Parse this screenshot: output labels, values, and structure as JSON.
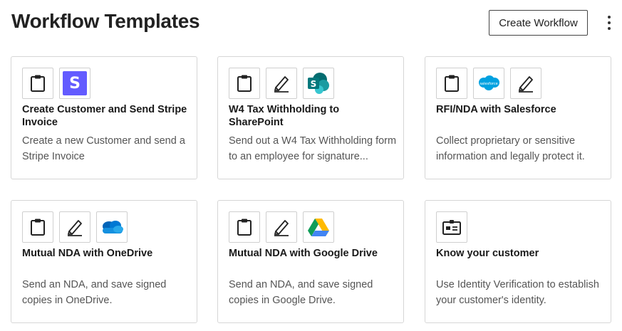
{
  "header": {
    "title": "Workflow Templates",
    "create_button_label": "Create Workflow"
  },
  "templates": [
    {
      "title": "Create Customer and Send Stripe Invoice",
      "description": "Create a new Customer and send a Stripe Invoice",
      "icons": [
        "clipboard-icon",
        "stripe-icon"
      ]
    },
    {
      "title": "W4 Tax Withholding to SharePoint",
      "description": "Send out a W4 Tax Withholding form to an employee for signature...",
      "icons": [
        "clipboard-icon",
        "pen-icon",
        "sharepoint-icon"
      ]
    },
    {
      "title": "RFI/NDA with Salesforce",
      "description": "Collect proprietary or sensitive information and legally protect it.",
      "icons": [
        "clipboard-icon",
        "salesforce-icon",
        "pen-icon"
      ]
    },
    {
      "title": "Mutual NDA with OneDrive",
      "description": "Send an NDA, and save signed copies in OneDrive.",
      "icons": [
        "clipboard-icon",
        "pen-icon",
        "onedrive-icon"
      ]
    },
    {
      "title": "Mutual NDA with Google Drive",
      "description": "Send an NDA, and save signed copies in Google Drive.",
      "icons": [
        "clipboard-icon",
        "pen-icon",
        "google-drive-icon"
      ]
    },
    {
      "title": "Know your customer",
      "description": "Use Identity Verification to establish your customer's identity.",
      "icons": [
        "id-card-icon"
      ]
    }
  ],
  "brand_colors": {
    "stripe": "#635bff",
    "sharepoint": "#038387",
    "salesforce": "#00a1e0",
    "onedrive": "#0364b8"
  },
  "logo_text": {
    "stripe": "S",
    "sharepoint": "S",
    "salesforce": "salesforce"
  }
}
